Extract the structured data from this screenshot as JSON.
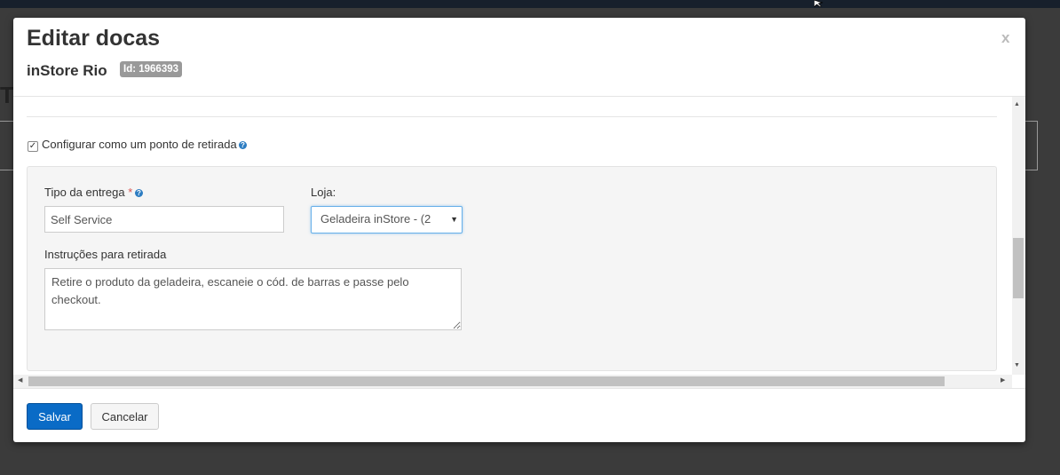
{
  "modal": {
    "title": "Editar docas",
    "close_label": "x",
    "subtitle": "inStore Rio",
    "id_badge": "Id: 1966393"
  },
  "pickup": {
    "checkbox_checked": true,
    "checkbox_label": "Configurar como um ponto de retirada",
    "help_icon": "?"
  },
  "form": {
    "delivery_type_label": "Tipo da entrega",
    "required_mark": "*",
    "delivery_type_value": "Self Service",
    "store_label": "Loja:",
    "store_value": "Geladeira inStore - (2",
    "instructions_label": "Instruções para retirada",
    "instructions_value": "Retire o produto da geladeira, escaneie o cód. de barras e passe pelo checkout."
  },
  "footer": {
    "save_label": "Salvar",
    "cancel_label": "Cancelar"
  },
  "background": {
    "partial_heading": "T"
  },
  "colors": {
    "primary": "#0a6bc6",
    "required": "#d9534f",
    "help": "#2d7dc2",
    "badge": "#999999",
    "overlay": "#3b3b3b"
  }
}
